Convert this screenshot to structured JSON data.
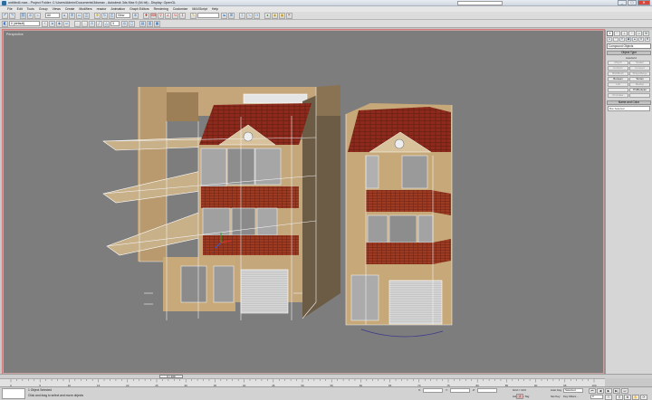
{
  "window": {
    "title": "untitled4.max - Project Folder: C:\\Users\\Admin\\Documents\\3dsmax - Autodesk 3ds Max 9 (64 bit) - Display: OpenGL",
    "search_placeholder": "",
    "buttons": [
      "_",
      "□",
      "✕"
    ]
  },
  "menu": [
    "File",
    "Edit",
    "Tools",
    "Group",
    "Views",
    "Create",
    "Modifiers",
    "reactor",
    "Animation",
    "Graph Editors",
    "Rendering",
    "Customize",
    "MAXScript",
    "Help"
  ],
  "main_toolbar": {
    "undo_icon": "undo-icon",
    "selection_filter": "All",
    "reference_coord": "View",
    "named_selection": ""
  },
  "second_toolbar": {
    "layer_combo": "0 (default)",
    "snaps_combo": "3"
  },
  "viewport": {
    "label": "Perspective",
    "background": "#7d7d7d"
  },
  "command_panel": {
    "tab_icons": [
      "create-tab-icon",
      "modify-tab-icon",
      "hierarchy-tab-icon",
      "motion-tab-icon",
      "display-tab-icon",
      "utilities-tab-icon"
    ],
    "category_combo": "Compound Objects",
    "object_type_title": "Object Type",
    "autogrid_label": "AutoGrid",
    "object_buttons": [
      {
        "label": "Morph",
        "enabled": false
      },
      {
        "label": "Scatter",
        "enabled": false
      },
      {
        "label": "Conform",
        "enabled": false
      },
      {
        "label": "Connect",
        "enabled": false
      },
      {
        "label": "BlobMesh",
        "enabled": false
      },
      {
        "label": "ShapeMerge",
        "enabled": false
      },
      {
        "label": "Boolean",
        "enabled": true
      },
      {
        "label": "Terrain",
        "enabled": true
      },
      {
        "label": "Loft",
        "enabled": false
      },
      {
        "label": "Mesher",
        "enabled": false
      },
      {
        "label": "",
        "enabled": false
      },
      {
        "label": "ProBoolean",
        "enabled": true
      },
      {
        "label": "ProCutter",
        "enabled": false
      },
      {
        "label": "",
        "enabled": false
      }
    ],
    "name_color_title": "Name and Color",
    "name_field": "Box Selected"
  },
  "time_slider": {
    "label": "0 / 100"
  },
  "trackbar": {
    "ticks": [
      "0",
      "5",
      "10",
      "15",
      "20",
      "25",
      "30",
      "35",
      "40",
      "45",
      "50",
      "55",
      "60",
      "65",
      "70",
      "75",
      "80",
      "85",
      "90",
      "95",
      "100"
    ]
  },
  "status": {
    "selection_text": "1 Object Selected",
    "prompt_text": "Click and drag to select and move objects",
    "x_label": "X:",
    "y_label": "Y:",
    "z_label": "Z:",
    "x_value": "",
    "y_value": "",
    "z_value": "",
    "grid_text": "Grid = 10.0",
    "add_time_tag": "Add Time Tag",
    "auto_key": "Auto Key",
    "set_key": "Set Key",
    "key_mode": "Selected",
    "key_filters": "Key Filters...",
    "frame_field": "0"
  }
}
